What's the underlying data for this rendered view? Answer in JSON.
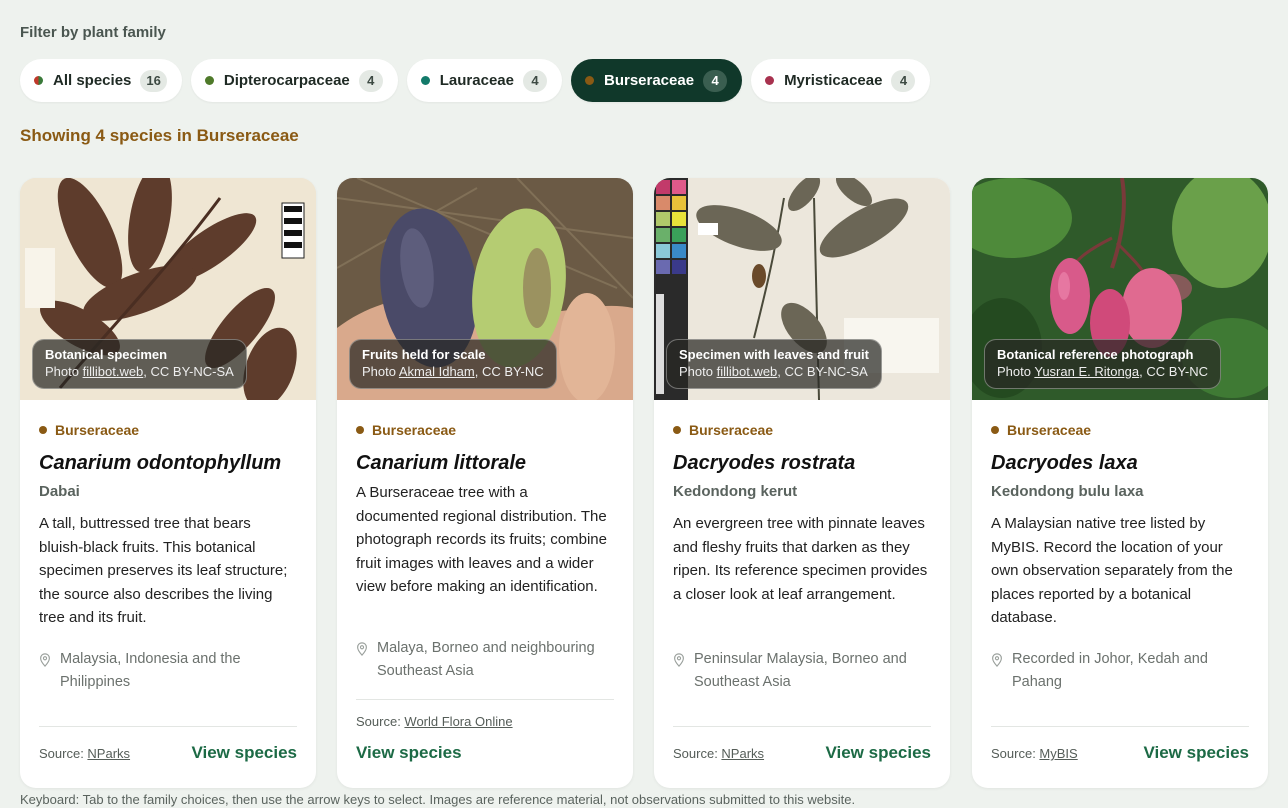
{
  "filter": {
    "label": "Filter by plant family",
    "chips": [
      {
        "label": "All species",
        "count": "16",
        "dot_color": "#c0392b-#3a7a3a",
        "active": false
      },
      {
        "label": "Dipterocarpaceae",
        "count": "4",
        "dot_color": "#4f7a2a",
        "active": false
      },
      {
        "label": "Lauraceae",
        "count": "4",
        "dot_color": "#137a6a",
        "active": false
      },
      {
        "label": "Burseraceae",
        "count": "4",
        "dot_color": "#8a5a14",
        "active": true
      },
      {
        "label": "Myristicaceae",
        "count": "4",
        "dot_color": "#a8324f",
        "active": false
      }
    ]
  },
  "showing": "Showing 4 species in Burseraceae",
  "cards": [
    {
      "caption_title": "Botanical specimen",
      "caption_prefix": "Photo ",
      "caption_author": "fillibot.web",
      "caption_license": ", CC BY-NC-SA",
      "family": "Burseraceae",
      "scientific": "Canarium odontophyllum",
      "common": "Dabai",
      "description": "A tall, buttressed tree that bears bluish-black fruits. This botanical specimen preserves its leaf structure; the source also describes the living tree and its fruit.",
      "location": "Malaysia, Indonesia and the Philippines",
      "source_prefix": "Source: ",
      "source_name": "NParks",
      "view": "View species"
    },
    {
      "caption_title": "Fruits held for scale",
      "caption_prefix": "Photo ",
      "caption_author": "Akmal Idham",
      "caption_license": ", CC BY-NC",
      "family": "Burseraceae",
      "scientific": "Canarium littorale",
      "common": "",
      "description": "A Burseraceae tree with a documented regional distribution. The photograph records its fruits; combine fruit images with leaves and a wider view before making an identification.",
      "location": "Malaya, Borneo and neighbouring Southeast Asia",
      "source_prefix": "Source: ",
      "source_name": "World Flora Online",
      "view": "View species"
    },
    {
      "caption_title": "Specimen with leaves and fruit",
      "caption_prefix": "Photo ",
      "caption_author": "fillibot.web",
      "caption_license": ", CC BY-NC-SA",
      "family": "Burseraceae",
      "scientific": "Dacryodes rostrata",
      "common": "Kedondong kerut",
      "description": "An evergreen tree with pinnate leaves and fleshy fruits that darken as they ripen. Its reference specimen provides a closer look at leaf arrangement.",
      "location": "Peninsular Malaysia, Borneo and Southeast Asia",
      "source_prefix": "Source: ",
      "source_name": "NParks",
      "view": "View species"
    },
    {
      "caption_title": "Botanical reference photograph",
      "caption_prefix": "Photo ",
      "caption_author": "Yusran E. Ritonga",
      "caption_license": ", CC BY-NC",
      "family": "Burseraceae",
      "scientific": "Dacryodes laxa",
      "common": "Kedondong bulu laxa",
      "description": "A Malaysian native tree listed by MyBIS. Record the location of your own observation separately from the places reported by a botanical database.",
      "location": "Recorded in Johor, Kedah and Pahang",
      "source_prefix": "Source: ",
      "source_name": "MyBIS",
      "view": "View species"
    }
  ],
  "footnote": "Keyboard: Tab to the family choices, then use the arrow keys to select. Images are reference material, not observations submitted to this website."
}
